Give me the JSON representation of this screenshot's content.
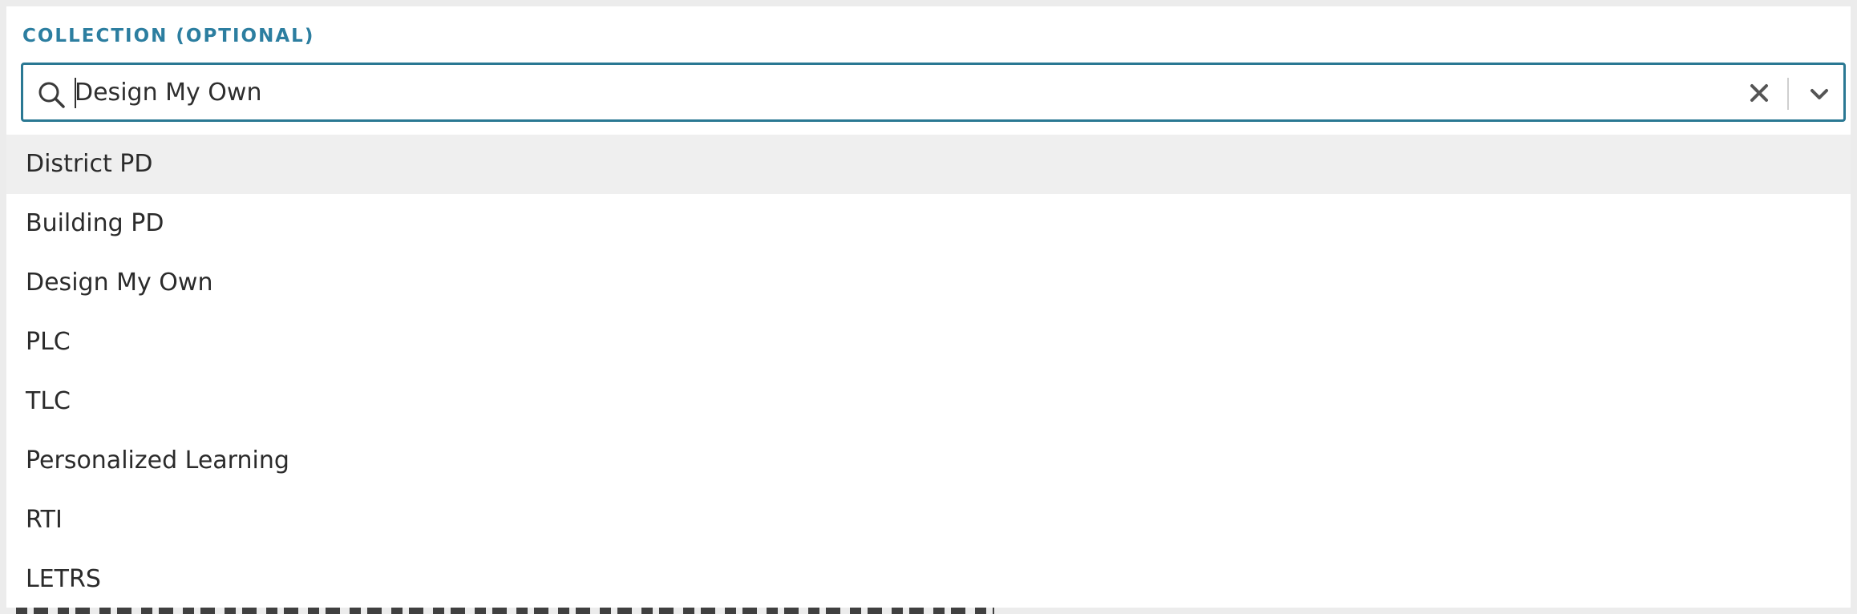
{
  "field": {
    "label": "COLLECTION (OPTIONAL)",
    "value": "Design My Own",
    "icons": {
      "search": "search-icon",
      "clear": "clear-icon",
      "dropdown": "chevron-down-icon"
    }
  },
  "colors": {
    "label": "#2c7ea0",
    "border_focus": "#2a7893",
    "option_highlight": "#efefef",
    "text": "#2b2b2b"
  },
  "options": [
    {
      "label": "District PD",
      "focused": true
    },
    {
      "label": "Building PD",
      "focused": false
    },
    {
      "label": "Design My Own",
      "focused": false
    },
    {
      "label": "PLC",
      "focused": false
    },
    {
      "label": "TLC",
      "focused": false
    },
    {
      "label": "Personalized Learning",
      "focused": false
    },
    {
      "label": "RTI",
      "focused": false
    },
    {
      "label": "LETRS",
      "focused": false
    }
  ]
}
